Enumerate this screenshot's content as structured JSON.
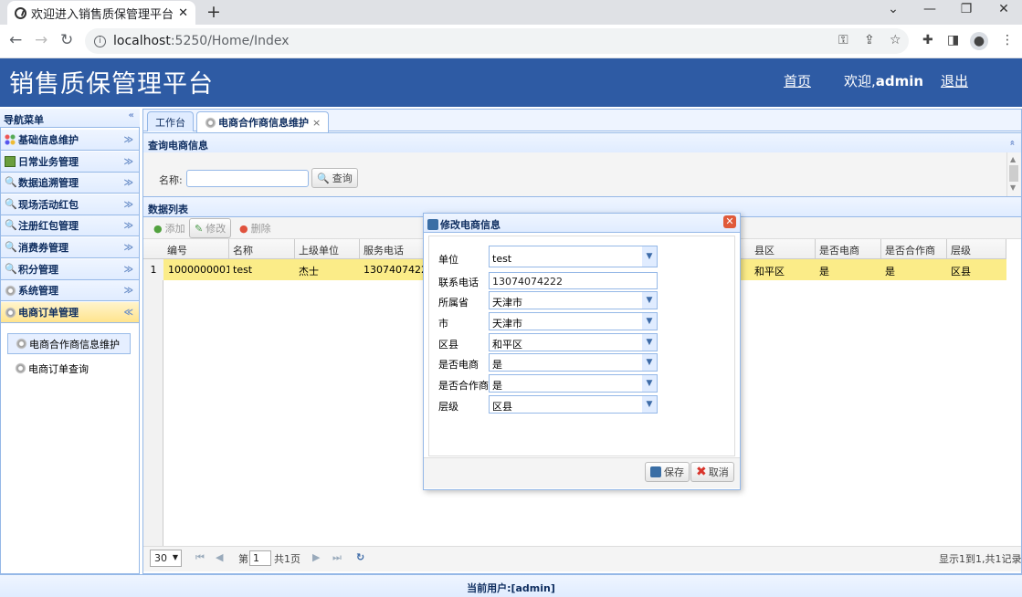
{
  "browser": {
    "tab_title": "欢迎进入销售质保管理平台",
    "url_host": "localhost",
    "url_rest": ":5250/Home/Index"
  },
  "header": {
    "title": "销售质保管理平台",
    "home": "首页",
    "welcome_prefix": "欢迎,",
    "user": "admin",
    "logout": "退出"
  },
  "nav": {
    "title": "导航菜单",
    "groups": [
      {
        "label": "基础信息维护"
      },
      {
        "label": "日常业务管理"
      },
      {
        "label": "数据追溯管理"
      },
      {
        "label": "现场活动红包"
      },
      {
        "label": "注册红包管理"
      },
      {
        "label": "消费券管理"
      },
      {
        "label": "积分管理"
      },
      {
        "label": "系统管理"
      },
      {
        "label": "电商订单管理"
      }
    ],
    "sub_items": [
      {
        "label": "电商合作商信息维护"
      },
      {
        "label": "电商订单查询"
      }
    ]
  },
  "tabs": [
    {
      "label": "工作台"
    },
    {
      "label": "电商合作商信息维护",
      "close": "×"
    }
  ],
  "query": {
    "title": "查询电商信息",
    "name_label": "名称:",
    "search": "查询"
  },
  "grid": {
    "title": "数据列表",
    "toolbar": {
      "add": "添加",
      "edit": "修改",
      "delete": "删除"
    },
    "columns": [
      "编号",
      "名称",
      "上级单位",
      "服务电话",
      "县区",
      "是否电商",
      "是否合作商",
      "层级"
    ],
    "rows": [
      {
        "num": "1",
        "id": "1000000001",
        "name": "test",
        "parent": "杰士",
        "phone": "13074074222",
        "county": "和平区",
        "is_ecom": "是",
        "is_partner": "是",
        "level": "区县"
      }
    ]
  },
  "pager": {
    "page_size": "30",
    "page_prefix": "第",
    "page_value": "1",
    "page_total": "共1页",
    "summary": "显示1到1,共1记录"
  },
  "status": "当前用户:[admin]",
  "dialog": {
    "title": "修改电商信息",
    "fields": [
      {
        "label": "单位",
        "value": "test"
      },
      {
        "label": "联系电话",
        "value": "13074074222"
      },
      {
        "label": "所属省",
        "value": "天津市"
      },
      {
        "label": "市",
        "value": "天津市"
      },
      {
        "label": "区县",
        "value": "和平区"
      },
      {
        "label": "是否电商",
        "value": "是"
      },
      {
        "label": "是否合作商",
        "value": "是"
      },
      {
        "label": "层级",
        "value": "区县"
      }
    ],
    "save": "保存",
    "cancel": "取消"
  }
}
